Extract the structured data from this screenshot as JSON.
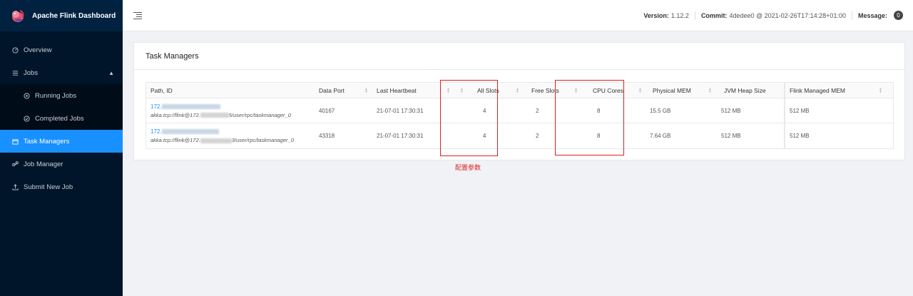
{
  "brand": {
    "title": "Apache Flink Dashboard"
  },
  "sidebar": {
    "items": [
      {
        "label": "Overview",
        "icon": "dashboard-icon"
      },
      {
        "label": "Jobs",
        "icon": "list-icon"
      },
      {
        "label": "Running Jobs",
        "icon": "play-circle-icon"
      },
      {
        "label": "Completed Jobs",
        "icon": "check-circle-icon"
      },
      {
        "label": "Task Managers",
        "icon": "schedule-icon"
      },
      {
        "label": "Job Manager",
        "icon": "cluster-icon"
      },
      {
        "label": "Submit New Job",
        "icon": "upload-icon"
      }
    ]
  },
  "header": {
    "version_label": "Version:",
    "version": "1.12.2",
    "commit_label": "Commit:",
    "commit": "4dedee0 @ 2021-02-26T17:14:28+01:00",
    "message_label": "Message:",
    "message_count": "0"
  },
  "page": {
    "title": "Task Managers"
  },
  "table": {
    "headers": [
      "Path, ID",
      "Data Port",
      "Last Heartbeat",
      "All Slots",
      "Free Slots",
      "CPU Cores",
      "Physical MEM",
      "JVM Heap Size",
      "Flink Managed MEM"
    ],
    "rows": [
      {
        "id": "172.",
        "addr_prefix": "akka.tcp://flink@172.",
        "addr_suffix": "5/user/rpc/taskmanager_0",
        "data_port": "40167",
        "heartbeat": "21-07-01 17:30:31",
        "all_slots": "4",
        "free_slots": "2",
        "cpu_cores": "8",
        "physical_mem": "15.5 GB",
        "jvm_heap": "512 MB",
        "managed_mem": "512 MB"
      },
      {
        "id": "172.",
        "addr_prefix": "akka.tcp://flink@172.",
        "addr_suffix": "3/user/rpc/taskmanager_0",
        "data_port": "43318",
        "heartbeat": "21-07-01 17:30:31",
        "all_slots": "4",
        "free_slots": "2",
        "cpu_cores": "8",
        "physical_mem": "7.64 GB",
        "jvm_heap": "512 MB",
        "managed_mem": "512 MB"
      }
    ]
  },
  "annotation": {
    "text": "配置参数",
    "color": "#e02020"
  }
}
